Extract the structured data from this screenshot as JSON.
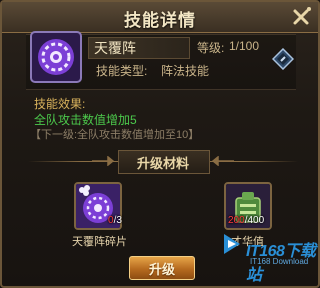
{
  "title": "技能详情",
  "skill": {
    "name": "天覆阵",
    "level_label": "等级:",
    "level_value": "1/100",
    "type_label": "技能类型:",
    "type_value": "阵法技能"
  },
  "effect": {
    "title": "技能效果:",
    "current": "全队攻击数值增加5",
    "next": "【下一级:全队攻击数值增加至10】"
  },
  "materials": {
    "title": "升级材料",
    "items": [
      {
        "name": "天覆阵碎片",
        "count_have": "0",
        "count_sep": "/",
        "count_need": "3",
        "icon": "skill-fragment-icon"
      },
      {
        "name": "才华值",
        "count_have": "200",
        "count_sep": "/",
        "count_need": "400",
        "icon": "talent-jade-icon"
      }
    ]
  },
  "upgrade_button": "升级",
  "watermark": {
    "brand": "IT168下载站",
    "sub": "IT168 Download"
  },
  "colors": {
    "accent_gold": "#d8b25c",
    "effect_green": "#4cc94c",
    "insufficient_red": "#ff3b3b",
    "button_orange": "#c97a25"
  }
}
